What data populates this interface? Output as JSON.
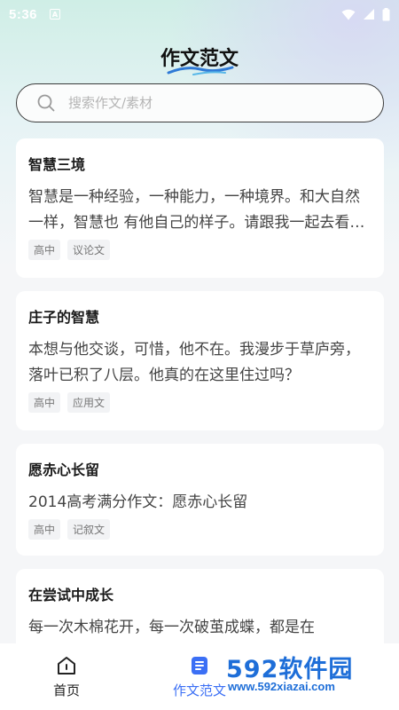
{
  "status_bar": {
    "time": "5:36",
    "notification_letter": "A"
  },
  "header": {
    "title": "作文范文"
  },
  "search": {
    "placeholder": "搜索作文/素材"
  },
  "articles": [
    {
      "title": "智慧三境",
      "excerpt": "智慧是一种经验，一种能力，一种境界。和大自然一样，智慧也 有他自己的样子。请跟我一起去看看智慧。",
      "tags": [
        "高中",
        "议论文"
      ]
    },
    {
      "title": "庄子的智慧",
      "excerpt": "本想与他交谈，可惜，他不在。我漫步于草庐旁，落叶已积了八层。他真的在这里住过吗？",
      "tags": [
        "高中",
        "应用文"
      ]
    },
    {
      "title": "愿赤心长留",
      "excerpt": "2014高考满分作文：愿赤心长留",
      "tags": [
        "高中",
        "记叙文"
      ]
    },
    {
      "title": "在尝试中成长",
      "excerpt": "每一次木棉花开，每一次破茧成蝶，都是在",
      "tags": []
    }
  ],
  "bottom_nav": {
    "items": [
      {
        "label": "首页",
        "icon": "home-icon",
        "active": false
      },
      {
        "label": "作文范文",
        "icon": "document-icon",
        "active": true
      }
    ]
  },
  "watermark": {
    "text": "592软件园",
    "url": "www.592xiazai.com"
  },
  "colors": {
    "accent": "#3b6ff5",
    "watermark": "#1e6ed8"
  }
}
